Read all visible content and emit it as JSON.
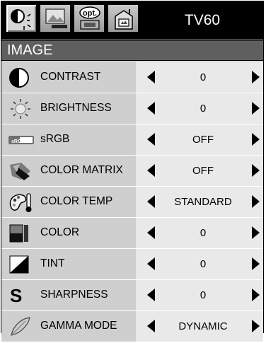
{
  "topbar": {
    "tabs": [
      {
        "name": "image-tab",
        "icon": "image-settings-icon",
        "active": true
      },
      {
        "name": "picture-tab",
        "icon": "picture-screen-icon",
        "active": false
      },
      {
        "name": "options-tab",
        "icon": "options-icon",
        "label": "opt.",
        "active": false
      },
      {
        "name": "setup-tab",
        "icon": "setup-icon",
        "active": false
      }
    ],
    "model": "TV60"
  },
  "menu_title": "IMAGE",
  "items": [
    {
      "icon": "contrast-icon",
      "label": "CONTRAST",
      "value": "0"
    },
    {
      "icon": "brightness-icon",
      "label": "BRIGHTNESS",
      "value": "0"
    },
    {
      "icon": "srgb-icon",
      "label": "sRGB",
      "value": "OFF",
      "icon_text": "sRGB"
    },
    {
      "icon": "color-matrix-icon",
      "label": "COLOR MATRIX",
      "value": "OFF"
    },
    {
      "icon": "color-temp-icon",
      "label": "COLOR TEMP",
      "value": "STANDARD"
    },
    {
      "icon": "color-icon",
      "label": "COLOR",
      "value": "0"
    },
    {
      "icon": "tint-icon",
      "label": "TINT",
      "value": "0"
    },
    {
      "icon": "sharpness-icon",
      "label": "SHARPNESS",
      "value": "0",
      "icon_text": "S"
    },
    {
      "icon": "gamma-mode-icon",
      "label": "GAMMA MODE",
      "value": "DYNAMIC"
    }
  ],
  "colors": {
    "topbar": "#000000",
    "header": "#5f5f5f",
    "label_bg": "#cfcfcf",
    "value_bg": "#e9e9e9"
  }
}
